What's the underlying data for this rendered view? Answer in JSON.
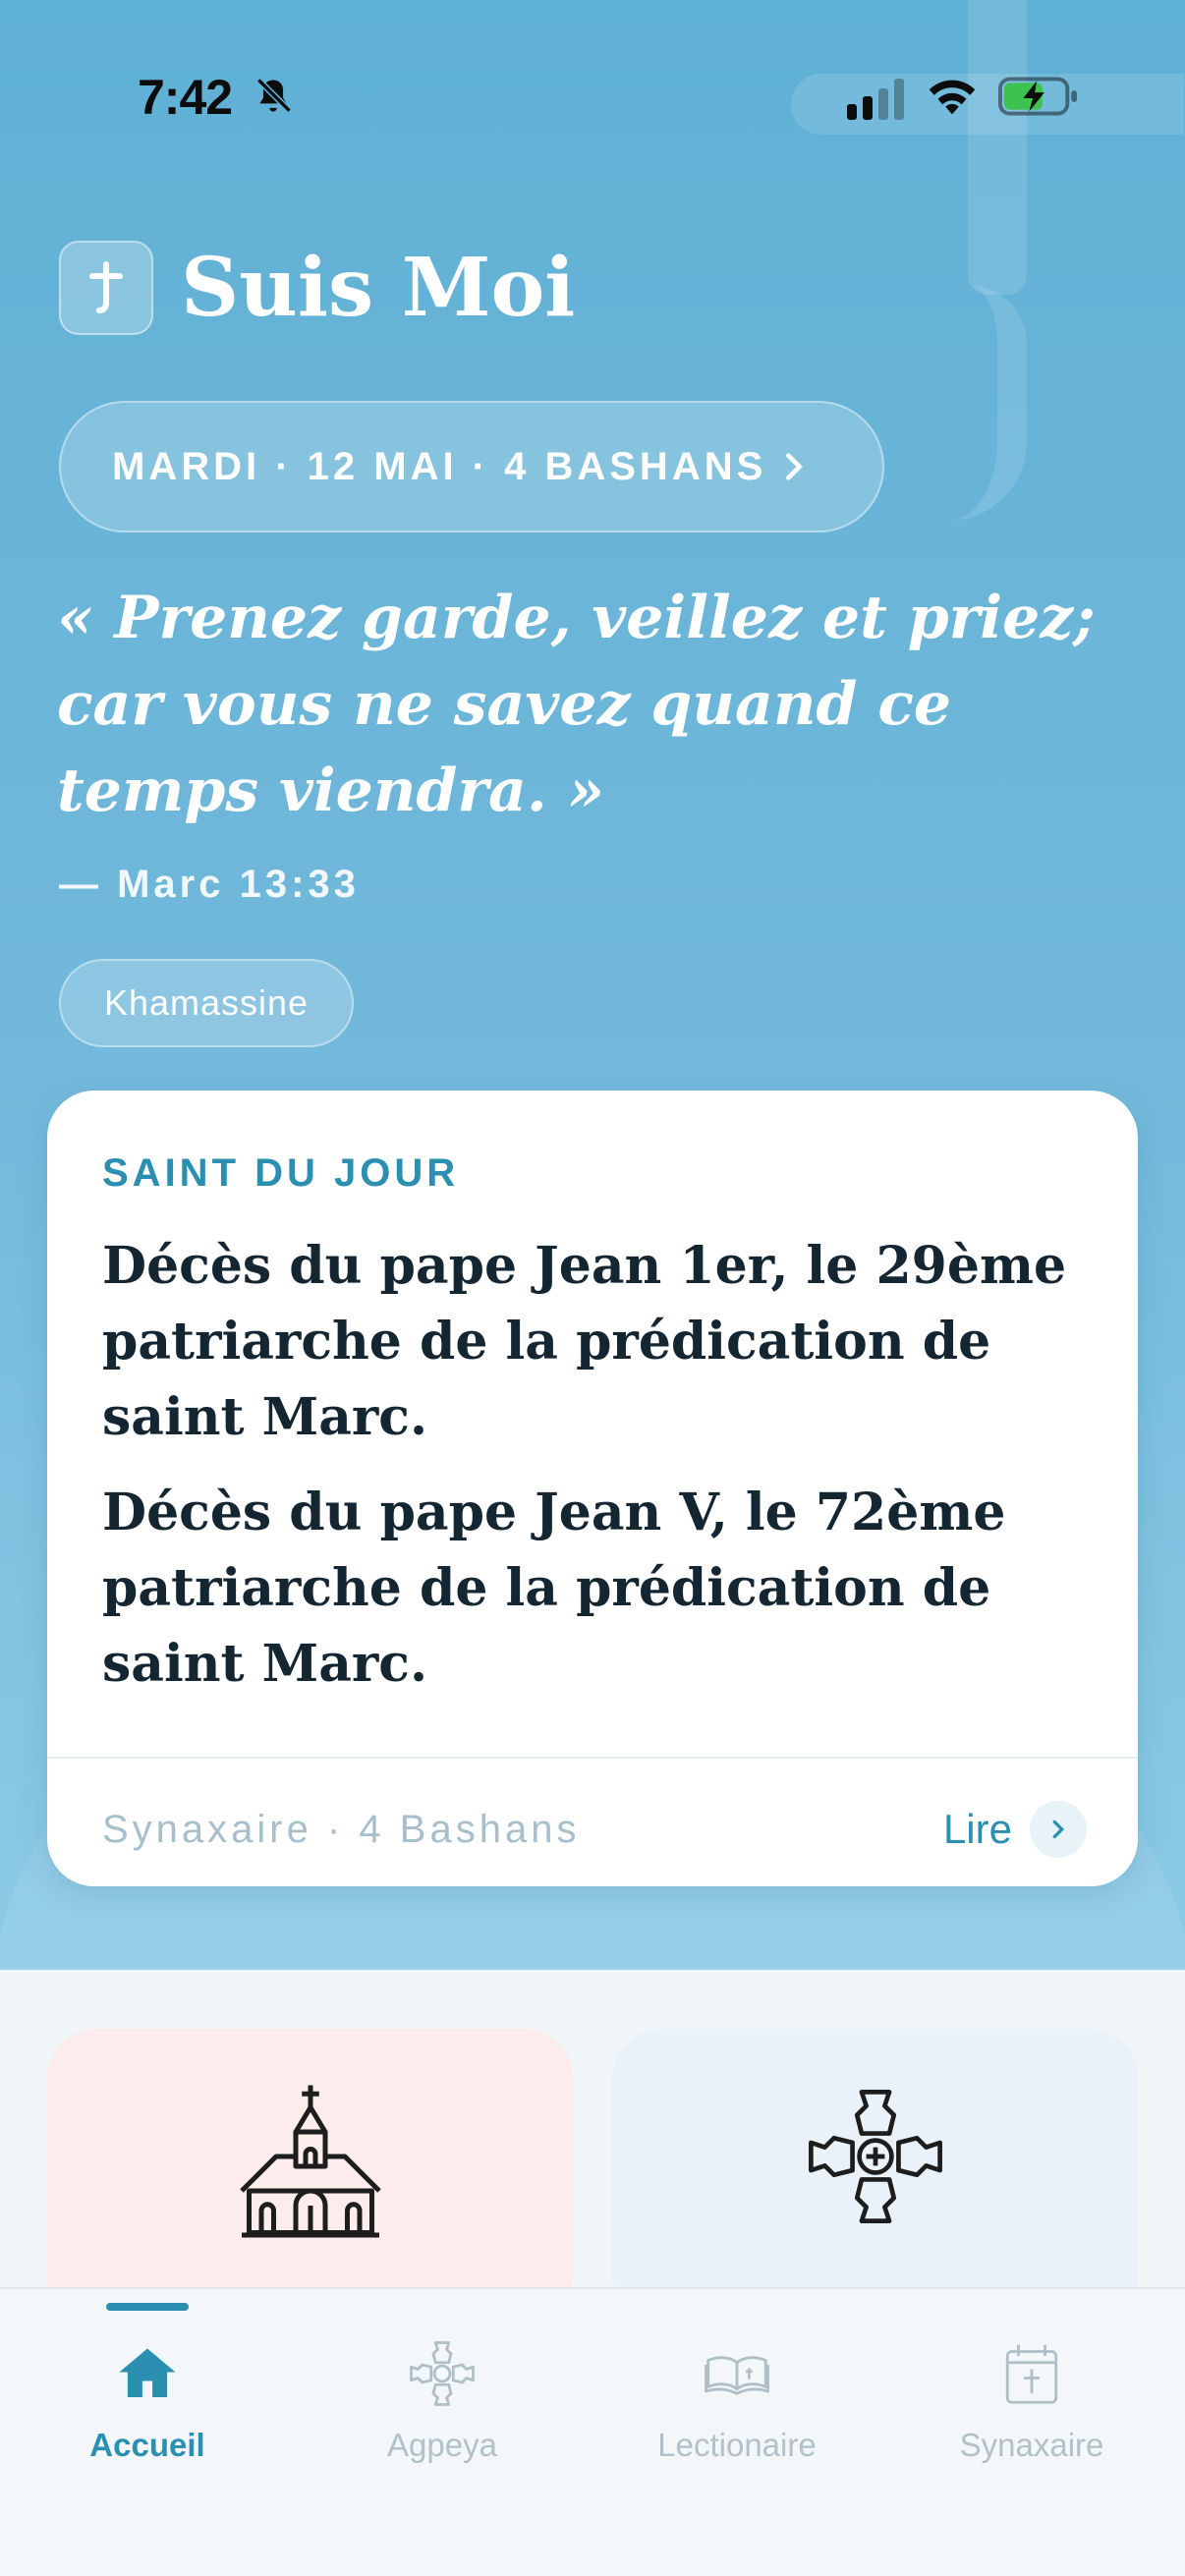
{
  "status_bar": {
    "time": "7:42"
  },
  "header": {
    "app_title": "Suis Moi",
    "date_label": "MARDI · 12 MAI · 4 BASHANS"
  },
  "verse": {
    "text": "« Prenez garde, veillez et priez; car vous ne savez quand ce temps viendra. »",
    "reference": "— Marc 13:33"
  },
  "season_chip": "Khamassine",
  "saint_card": {
    "label": "SAINT DU JOUR",
    "entries": [
      "Décès du pape Jean 1er, le 29ème patriarche de la prédication de saint Marc.",
      "Décès du pape Jean V, le 72ème patriarche de la prédication de saint Marc."
    ],
    "source": "Synaxaire · 4 Bashans",
    "read_label": "Lire"
  },
  "tabs": [
    {
      "label": "Accueil",
      "icon": "home-icon",
      "active": true
    },
    {
      "label": "Agpeya",
      "icon": "coptic-cross-icon",
      "active": false
    },
    {
      "label": "Lectionaire",
      "icon": "open-book-icon",
      "active": false
    },
    {
      "label": "Synaxaire",
      "icon": "calendar-cross-icon",
      "active": false
    }
  ],
  "colors": {
    "hero_top": "#5fb0d5",
    "accent": "#2a8fb0",
    "title_text": "#152633",
    "muted": "#b0c1ca"
  }
}
